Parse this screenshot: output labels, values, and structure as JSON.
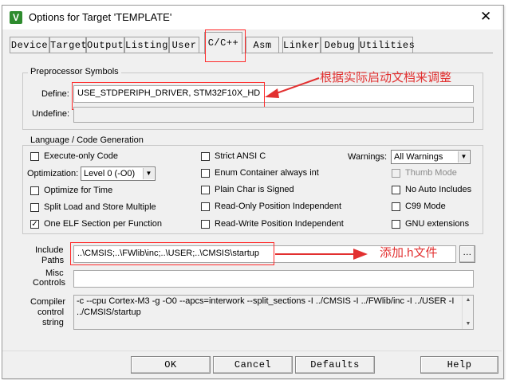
{
  "window": {
    "title": "Options for Target 'TEMPLATE'",
    "app_icon_glyph": "V",
    "close_glyph": "✕"
  },
  "tabs": [
    {
      "label": "Device"
    },
    {
      "label": "Target"
    },
    {
      "label": "Output"
    },
    {
      "label": "Listing"
    },
    {
      "label": "User"
    },
    {
      "label": "C/C++"
    },
    {
      "label": "Asm"
    },
    {
      "label": "Linker"
    },
    {
      "label": "Debug"
    },
    {
      "label": "Utilities"
    }
  ],
  "active_tab": "C/C++",
  "preprocessor": {
    "group_title": "Preprocessor Symbols",
    "define_label": "Define:",
    "define_value": "USE_STDPERIPH_DRIVER, STM32F10X_HD",
    "undefine_label": "Undefine:",
    "undefine_value": ""
  },
  "language": {
    "group_title": "Language / Code Generation",
    "col1": [
      {
        "label": "Execute-only Code",
        "checked": false
      },
      {
        "label": "Optimize for Time",
        "checked": false
      },
      {
        "label": "Split Load and Store Multiple",
        "checked": false
      },
      {
        "label": "One ELF Section per Function",
        "checked": true
      }
    ],
    "optimization_label": "Optimization:",
    "optimization_value": "Level 0 (-O0)",
    "col2": [
      {
        "label": "Strict ANSI C",
        "checked": false
      },
      {
        "label": "Enum Container always int",
        "checked": false
      },
      {
        "label": "Plain Char is Signed",
        "checked": false
      },
      {
        "label": "Read-Only Position Independent",
        "checked": false
      },
      {
        "label": "Read-Write Position Independent",
        "checked": false
      }
    ],
    "warnings_label": "Warnings:",
    "warnings_value": "All Warnings",
    "col3": [
      {
        "label": "Thumb Mode",
        "checked": false,
        "disabled": true
      },
      {
        "label": "No Auto Includes",
        "checked": false
      },
      {
        "label": "C99 Mode",
        "checked": false
      },
      {
        "label": "GNU extensions",
        "checked": false
      }
    ]
  },
  "include": {
    "label_line1": "Include",
    "label_line2": "Paths",
    "value": "..\\CMSIS;..\\FWlib\\inc;..\\USER;..\\CMSIS\\startup",
    "browse_label": "...",
    "misc_label_line1": "Misc",
    "misc_label_line2": "Controls",
    "misc_value": ""
  },
  "compiler": {
    "label_line1": "Compiler",
    "label_line2": "control",
    "label_line3": "string",
    "line1": "-c --cpu Cortex-M3 -g -O0 --apcs=interwork --split_sections -I ../CMSIS -I ../FWlib/inc -I ../USER -I",
    "line2": "../CMSIS/startup"
  },
  "buttons": {
    "ok": "OK",
    "cancel": "Cancel",
    "defaults": "Defaults",
    "help": "Help"
  },
  "annotations": {
    "define_note": "根据实际启动文档来调整",
    "include_note": "添加.h文件"
  },
  "colors": {
    "annotation_red": "#e23030",
    "dialog_bg": "#f0f0f0"
  }
}
